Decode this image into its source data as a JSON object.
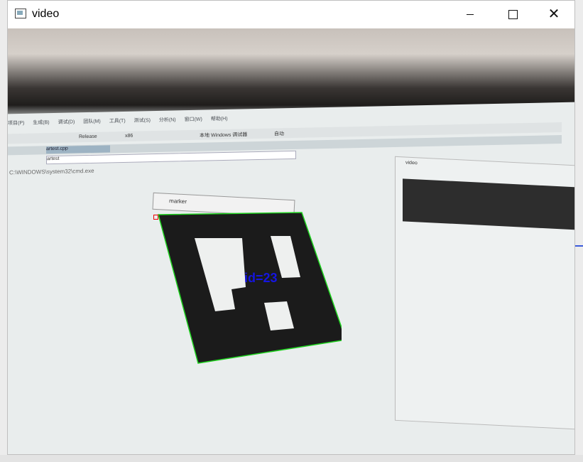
{
  "window": {
    "title": "video",
    "controls": {
      "minimize": "—",
      "maximize": "□",
      "close": "✕"
    }
  },
  "video_frame": {
    "menu_items": [
      "项目(P)",
      "生成(B)",
      "调试(D)",
      "团队(M)",
      "工具(T)",
      "测试(S)",
      "分析(N)",
      "窗口(W)",
      "帮助(H)"
    ],
    "toolbar": {
      "config": "Release",
      "platform": "x86",
      "run_label": "本地 Windows 调试器",
      "zoom": "自动"
    },
    "tab_label": "artest.cpp",
    "address_label": "artest",
    "path_text": "C:\\WINDOWS\\system32\\cmd.exe",
    "marker_window_title": "marker",
    "right_window_title": "video",
    "overlay": {
      "id_text": "id=23",
      "text_color": "#1515e0",
      "outline_color": "#1fd11f",
      "corner_color": "#e00000"
    }
  }
}
